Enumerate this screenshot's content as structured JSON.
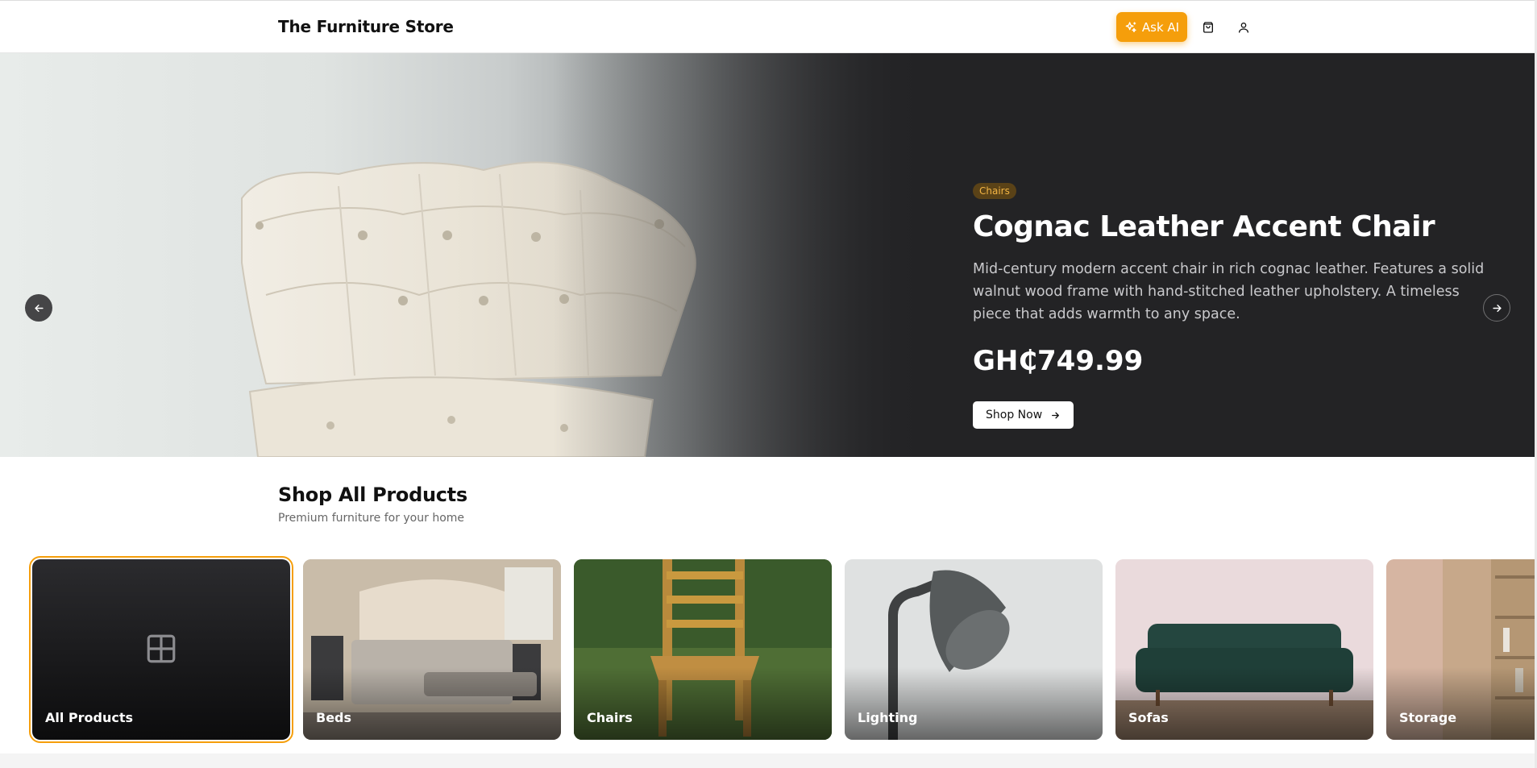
{
  "header": {
    "brand": "The Furniture Store",
    "ask_ai_label": "Ask AI",
    "cart_icon": "shopping-bag-icon",
    "account_icon": "user-icon",
    "accent_color": "#f59e0b"
  },
  "hero": {
    "category_badge": "Chairs",
    "title": "Cognac Leather Accent Chair",
    "description": "Mid-century modern accent chair in rich cognac leather. Features a solid walnut wood frame with hand-stitched leather upholstery. A timeless piece that adds warmth to any space.",
    "price": "GH₵749.99",
    "cta_label": "Shop Now",
    "slide_count": 6,
    "active_slide": 3
  },
  "section": {
    "title": "Shop All Products",
    "subtitle": "Premium furniture for your home"
  },
  "categories": [
    {
      "label": "All Products",
      "selected": true
    },
    {
      "label": "Beds",
      "selected": false
    },
    {
      "label": "Chairs",
      "selected": false
    },
    {
      "label": "Lighting",
      "selected": false
    },
    {
      "label": "Sofas",
      "selected": false
    },
    {
      "label": "Storage",
      "selected": false
    }
  ]
}
